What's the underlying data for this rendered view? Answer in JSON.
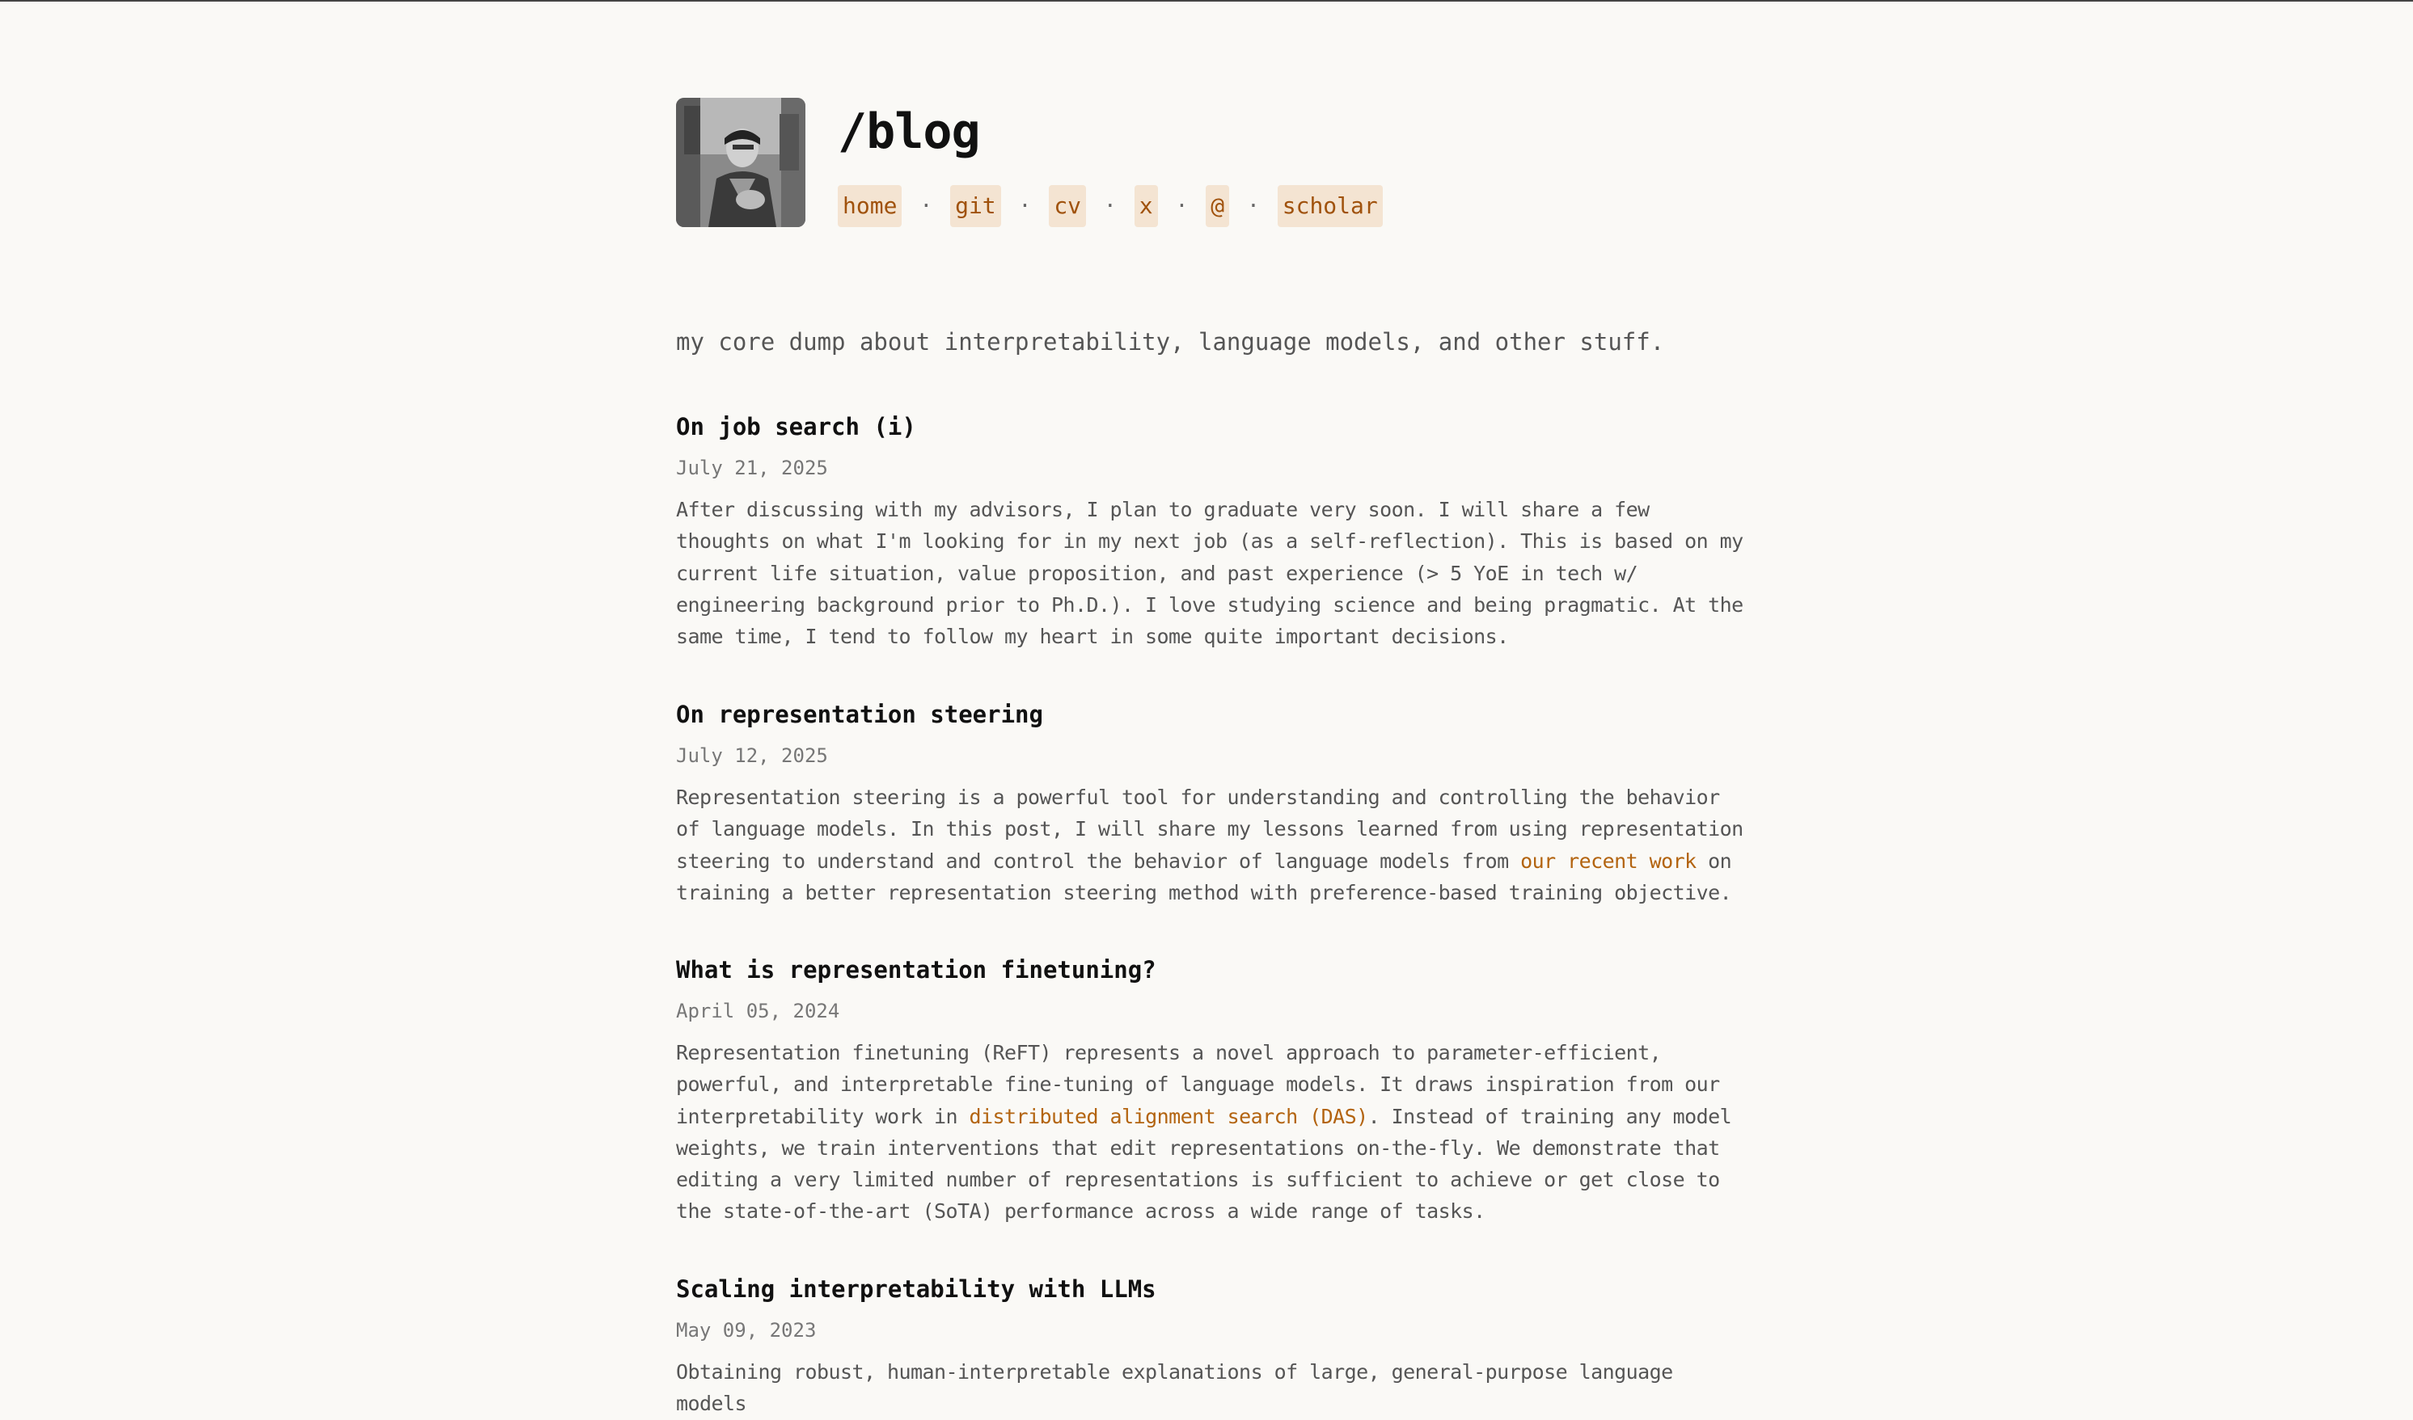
{
  "header": {
    "title": "/blog",
    "nav": [
      "home",
      "git",
      "cv",
      "x",
      "@",
      "scholar"
    ],
    "separator": "·"
  },
  "tagline": "my core dump about interpretability, language models, and other stuff.",
  "posts": [
    {
      "title": "On job search (i)",
      "date": "July 21, 2025",
      "excerpt": "After discussing with my advisors, I plan to graduate very soon. I will share a few thoughts on what I'm looking for in my next job (as a self-reflection). This is based on my current life situation, value proposition, and past experience (> 5 YoE in tech w/ engineering background prior to Ph.D.). I love studying science and being pragmatic. At the same time, I tend to follow my heart in some quite important decisions."
    },
    {
      "title": "On representation steering",
      "date": "July 12, 2025",
      "excerpt_before": "Representation steering is a powerful tool for understanding and controlling the behavior of language models. In this post, I will share my lessons learned from using representation steering to understand and control the behavior of language models from ",
      "excerpt_link": "our recent work",
      "excerpt_after": " on training a better representation steering method with preference-based training objective."
    },
    {
      "title": "What is representation finetuning?",
      "date": "April 05, 2024",
      "excerpt_before": "Representation finetuning (ReFT) represents a novel approach to parameter-efficient, powerful, and interpretable fine-tuning of language models. It draws inspiration from our interpretability work in ",
      "excerpt_link": "distributed alignment search (DAS)",
      "excerpt_after": ". Instead of training any model weights, we train interventions that edit representations on-the-fly. We demonstrate that editing a very limited number of representations is sufficient to achieve or get close to the state-of-the-art (SoTA) performance across a wide range of tasks."
    },
    {
      "title": "Scaling interpretability with LLMs",
      "date": "May 09, 2023",
      "excerpt": "Obtaining robust, human-interpretable explanations of large, general-purpose language models"
    }
  ],
  "colors": {
    "background": "#faf9f6",
    "link": "#a0520d",
    "link_bg": "#f4e4d2",
    "title": "#111111",
    "body": "#555555"
  }
}
